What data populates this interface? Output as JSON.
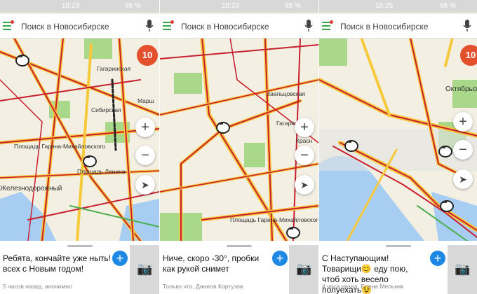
{
  "panels": [
    {
      "status": {
        "time": "18:23",
        "battery": "65 %"
      },
      "search": {
        "placeholder": "Поиск в Новосибирске"
      },
      "badge": "10",
      "labels": {
        "gagarinskaya": "Гагаринская",
        "sibirskaya": "Сибирская",
        "ploshchad_garina": "Площадь Гарина-Михайловского",
        "ploshchad_lenina": "Площадь Ленина",
        "zheleznodorozhny": "Железнодорожный",
        "marshala": "Марш"
      },
      "post": {
        "message": "Ребята, кончайте уже ныть! всех с Новым годом!",
        "meta": "5 часов назад, анонимно"
      }
    },
    {
      "status": {
        "time": "18:23",
        "battery": "65 %"
      },
      "search": {
        "placeholder": "Поиск в Новосибирске"
      },
      "labels": {
        "zaeltsovskaya": "Заельцовская",
        "gagarinskaya": "Гагаринская",
        "ploshchad_garina": "Площадь Гарина-Михайловского",
        "krasny": "Красн"
      },
      "post": {
        "message": "Ниче, скоро -30°, пробки как рукой снимет",
        "meta": "Только что, Данила Кортузов"
      }
    },
    {
      "status": {
        "time": "18:25",
        "battery": "65 %"
      },
      "search": {
        "placeholder": "Поиск в Новосибирске"
      },
      "badge": "10",
      "labels": {
        "oktyabrskaya": "Октябрьск"
      },
      "post": {
        "message": "С Наступающим! Товарищи😊 еду пою, чтоб хоть весело полуехать😉",
        "meta": "4 часа назад, Елена Мельник"
      }
    }
  ],
  "colors": {
    "map_bg": "#f3efe3",
    "road_major": "#f7c93c",
    "traffic_red": "#c8202f",
    "park": "#a9d88a",
    "water": "#a7cdf2",
    "accent_blue": "#1e88e5",
    "badge": "#e2502c",
    "menu_green": "#3aa64c"
  },
  "icons": {
    "menu": "hamburger-icon",
    "mic": "microphone-icon",
    "zoom_in": "plus-icon",
    "zoom_out": "minus-icon",
    "locate": "navigation-arrow-icon",
    "camera": "camera-icon",
    "comment": "speech-bubble-icon",
    "add": "plus-icon"
  }
}
